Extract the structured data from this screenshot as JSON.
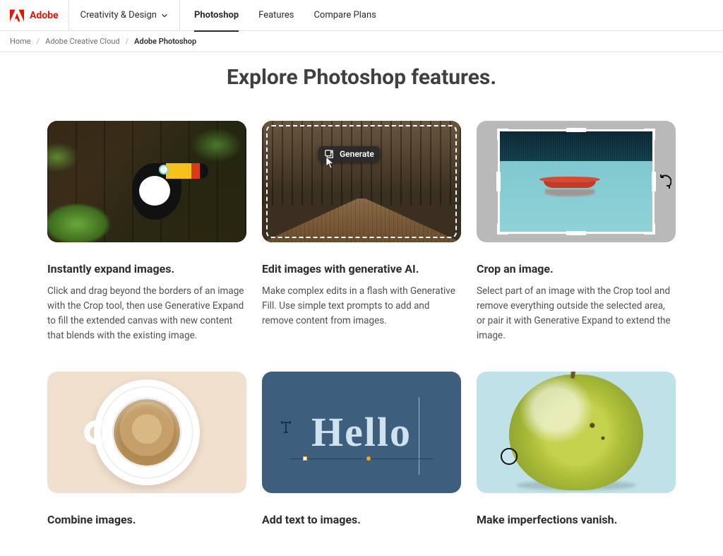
{
  "header": {
    "brand": "Adobe",
    "nav_dropdown": "Creativity & Design",
    "tabs": [
      "Photoshop",
      "Features",
      "Compare Plans"
    ],
    "active_tab_index": 0
  },
  "breadcrumb": {
    "items": [
      "Home",
      "Adobe Creative Cloud",
      "Adobe Photoshop"
    ]
  },
  "page": {
    "title": "Explore Photoshop features."
  },
  "thumb2": {
    "generate_label": "Generate"
  },
  "thumb5": {
    "text": "Hello"
  },
  "features": [
    {
      "title": "Instantly expand images.",
      "body": "Click and drag beyond the borders of an image with the Crop tool, then use Generative Expand to fill the extended canvas with new content that blends with the existing image."
    },
    {
      "title": "Edit images with generative AI.",
      "body": "Make complex edits in a flash with Generative Fill. Use simple text prompts to add and remove content from images."
    },
    {
      "title": "Crop an image.",
      "body": "Select part of an image with the Crop tool and remove everything outside the selected area, or pair it with Generative Expand to extend the image."
    },
    {
      "title": "Combine images.",
      "body": ""
    },
    {
      "title": "Add text to images.",
      "body": ""
    },
    {
      "title": "Make imperfections vanish.",
      "body": ""
    }
  ]
}
